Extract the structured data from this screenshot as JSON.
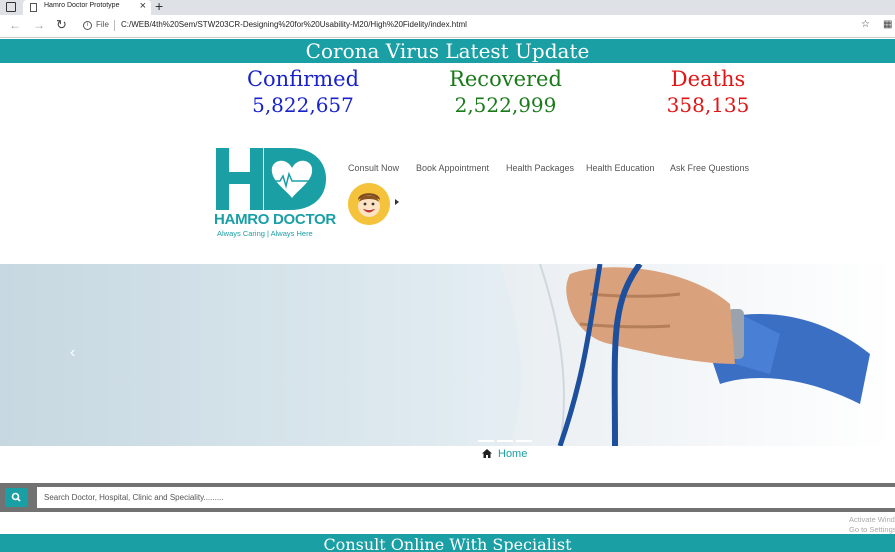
{
  "browser": {
    "tab_title": "Hamro Doctor Prototype",
    "tab_close": "×",
    "new_tab": "+",
    "file_label": "File",
    "url": "C:/WEB/4th%20Sem/STW203CR-Designing%20for%20Usability-M20/High%20Fidelity/index.html"
  },
  "corona": {
    "title": "Corona Virus Latest Update",
    "stats": [
      {
        "label": "Confirmed",
        "value": "5,822,657",
        "color": "#1a23c9"
      },
      {
        "label": "Recovered",
        "value": "2,522,999",
        "color": "#1a7a1a"
      },
      {
        "label": "Deaths",
        "value": "358,135",
        "color": "#e21414"
      }
    ]
  },
  "logo": {
    "name": "HAMRO DOCTOR",
    "tagline": "Always Caring | Always Here"
  },
  "nav": {
    "items": [
      "Consult Now",
      "Book Appointment",
      "Health Packages",
      "Health Education",
      "Ask Free Questions"
    ]
  },
  "hero": {
    "prev_glyph": "‹",
    "slides": 3
  },
  "breadcrumb": {
    "home": "Home"
  },
  "search": {
    "placeholder": "Search Doctor, Hospital, Clinic and Speciality........."
  },
  "watermark": {
    "line1": "Activate Windows",
    "line2": "Go to Settings"
  },
  "consult": {
    "title": "Consult Online With Specialist"
  },
  "colors": {
    "brand": "#1a9fa5",
    "search_bar": "#727272"
  }
}
